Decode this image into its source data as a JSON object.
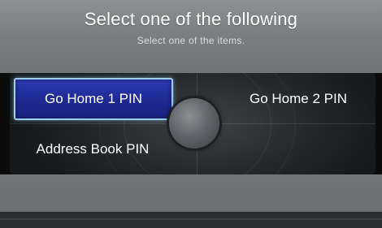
{
  "header": {
    "title": "Select one of the following",
    "subtitle": "Select one of the items."
  },
  "options": [
    {
      "label": "Go Home 1 PIN",
      "selected": true
    },
    {
      "label": "Go Home 2 PIN",
      "selected": false
    },
    {
      "label": "Address Book PIN",
      "selected": false
    }
  ],
  "colors": {
    "header_bg": "#7f8586",
    "selected_bg": "#1f2a92",
    "selected_border": "#9ecdf0",
    "text": "#ffffff"
  }
}
